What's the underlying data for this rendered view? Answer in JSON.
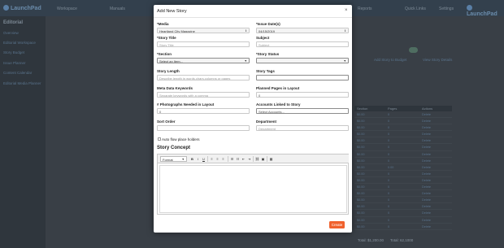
{
  "app": {
    "logo_left": "LaunchPad",
    "logo_right": "LaunchPad",
    "nav": [
      "Workspace",
      "Manuals",
      "Reports",
      "Quick Links",
      "Settings"
    ],
    "sidebar_title": "Editorial",
    "sidebar_items": [
      "Overview",
      "Editorial Workspace",
      "Story Budget",
      "Issue Planner",
      "Content Calendar",
      "Editorial Media Planner"
    ],
    "background_link_1": "Add Story to Budget",
    "background_link_2": "View Story Details",
    "table_headers": [
      "Section",
      "Pages",
      "Actions"
    ],
    "table_rows": [
      [
        "$0.00",
        "0",
        "Delete"
      ],
      [
        "$0.00",
        "0",
        "Delete"
      ],
      [
        "$0.00",
        "0",
        "Delete"
      ],
      [
        "$0.00",
        "0",
        "Delete"
      ],
      [
        "$0.00",
        "0",
        "Delete"
      ],
      [
        "$0.00",
        "0",
        "Delete"
      ],
      [
        "$0.00",
        "0",
        "Delete"
      ],
      [
        "$0.00",
        "0",
        "Delete"
      ],
      [
        "$0.00",
        "0.00",
        "Delete"
      ],
      [
        "$0.00",
        "0",
        "Delete"
      ],
      [
        "$0.00",
        "0",
        "Delete"
      ],
      [
        "$0.00",
        "0",
        "Delete"
      ],
      [
        "$0.00",
        "0",
        "Delete"
      ],
      [
        "$0.00",
        "0",
        "Delete"
      ],
      [
        "$0.00",
        "0",
        "Delete"
      ],
      [
        "$0.00",
        "0",
        "Delete"
      ],
      [
        "$0.00",
        "0",
        "Delete"
      ],
      [
        "$0.00",
        "0",
        "Delete"
      ]
    ],
    "total_cost": "Total: $1,200.00",
    "total_pages": "Total: 62,1000"
  },
  "modal": {
    "title": "Add New Story",
    "close": "×",
    "media": {
      "label": "*Media",
      "value": "Heartland City Magazine"
    },
    "issue_dates": {
      "label": "*Issue Date(s)",
      "value": "04/15/2019"
    },
    "story_title": {
      "label": "*Story Title",
      "placeholder": "Story Title"
    },
    "subject": {
      "label": "Subject",
      "placeholder": "Subject"
    },
    "section": {
      "label": "*Section",
      "value": "Select an Item..."
    },
    "story_status": {
      "label": "*Story Status",
      "value": ""
    },
    "story_length": {
      "label": "Story Length",
      "placeholder": "Describe length in words,chars,columns or pages"
    },
    "story_tags": {
      "label": "Story Tags",
      "value": ""
    },
    "meta_keywords": {
      "label": "Meta Data Keywords",
      "placeholder": "Separate keywords with a comma"
    },
    "planned_pages": {
      "label": "Planned Pages in Layout",
      "value": "0"
    },
    "photographs": {
      "label": "# Photographs Needed in Layout",
      "value": "0"
    },
    "accounts": {
      "label": "Accounts Linked to Story",
      "value": "Select Accounts..."
    },
    "sort_order": {
      "label": "Sort Order",
      "value": ""
    },
    "department": {
      "label": "Department",
      "placeholder": "Department"
    },
    "auto_flow": {
      "label": "Auto flow place holders",
      "checked": false
    },
    "story_concept": {
      "label": "Story Concept",
      "format_value": "Format",
      "toolbar_icons": [
        "bold-icon",
        "italic-icon",
        "underline-icon",
        "align-left-icon",
        "align-center-icon",
        "align-right-icon",
        "bullet-list-icon",
        "numbered-list-icon",
        "outdent-icon",
        "indent-icon",
        "link-icon",
        "image-icon",
        "table-icon"
      ],
      "glyphs": {
        "bold": "B",
        "italic": "I",
        "underline": "U"
      }
    },
    "create_label": "Create",
    "colors": {
      "accent": "#f0612d",
      "overlay": "#3a4149"
    }
  }
}
